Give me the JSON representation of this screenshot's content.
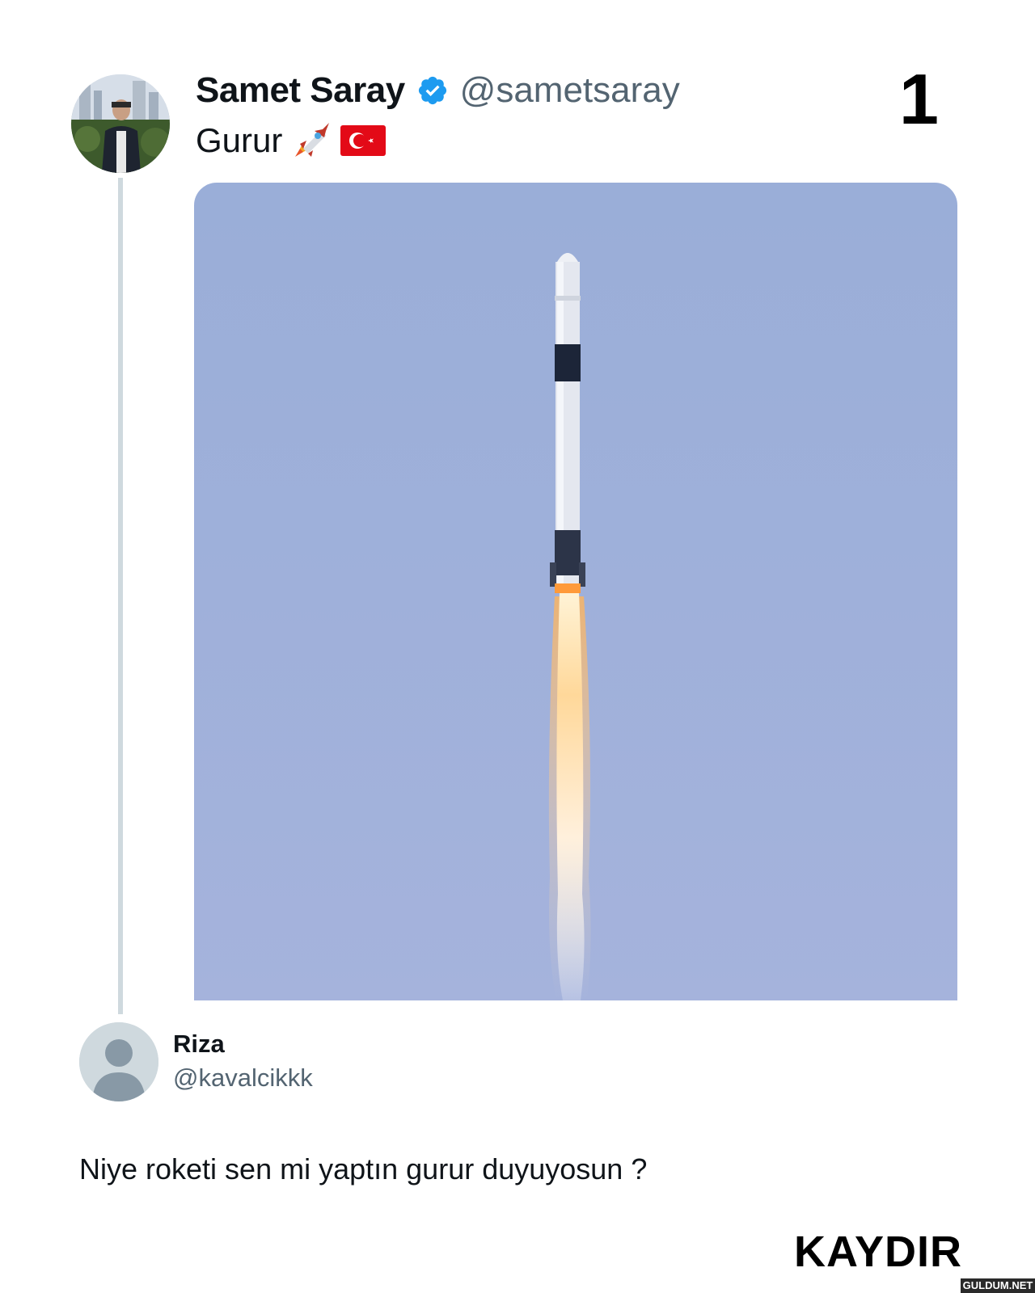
{
  "tweet": {
    "display_name": "Samet Saray",
    "handle": "@sametsaray",
    "text": "Gurur",
    "emojis": [
      "rocket-icon",
      "turkey-flag-icon"
    ],
    "verified": true,
    "media_alt": "rocket-launch-photo"
  },
  "slide_number": "1",
  "reply": {
    "display_name": "Riza",
    "handle": "@kavalcikkk",
    "text": "Niye roketi sen mi yaptın gurur duyuyosun ?"
  },
  "footer": {
    "swipe_label": "KAYDIR",
    "watermark": "GULDUM.NET"
  },
  "colors": {
    "verified_blue": "#1d9bf0",
    "secondary_text": "#536471",
    "sky": "#9fb0da",
    "flag_red": "#e30a17"
  }
}
